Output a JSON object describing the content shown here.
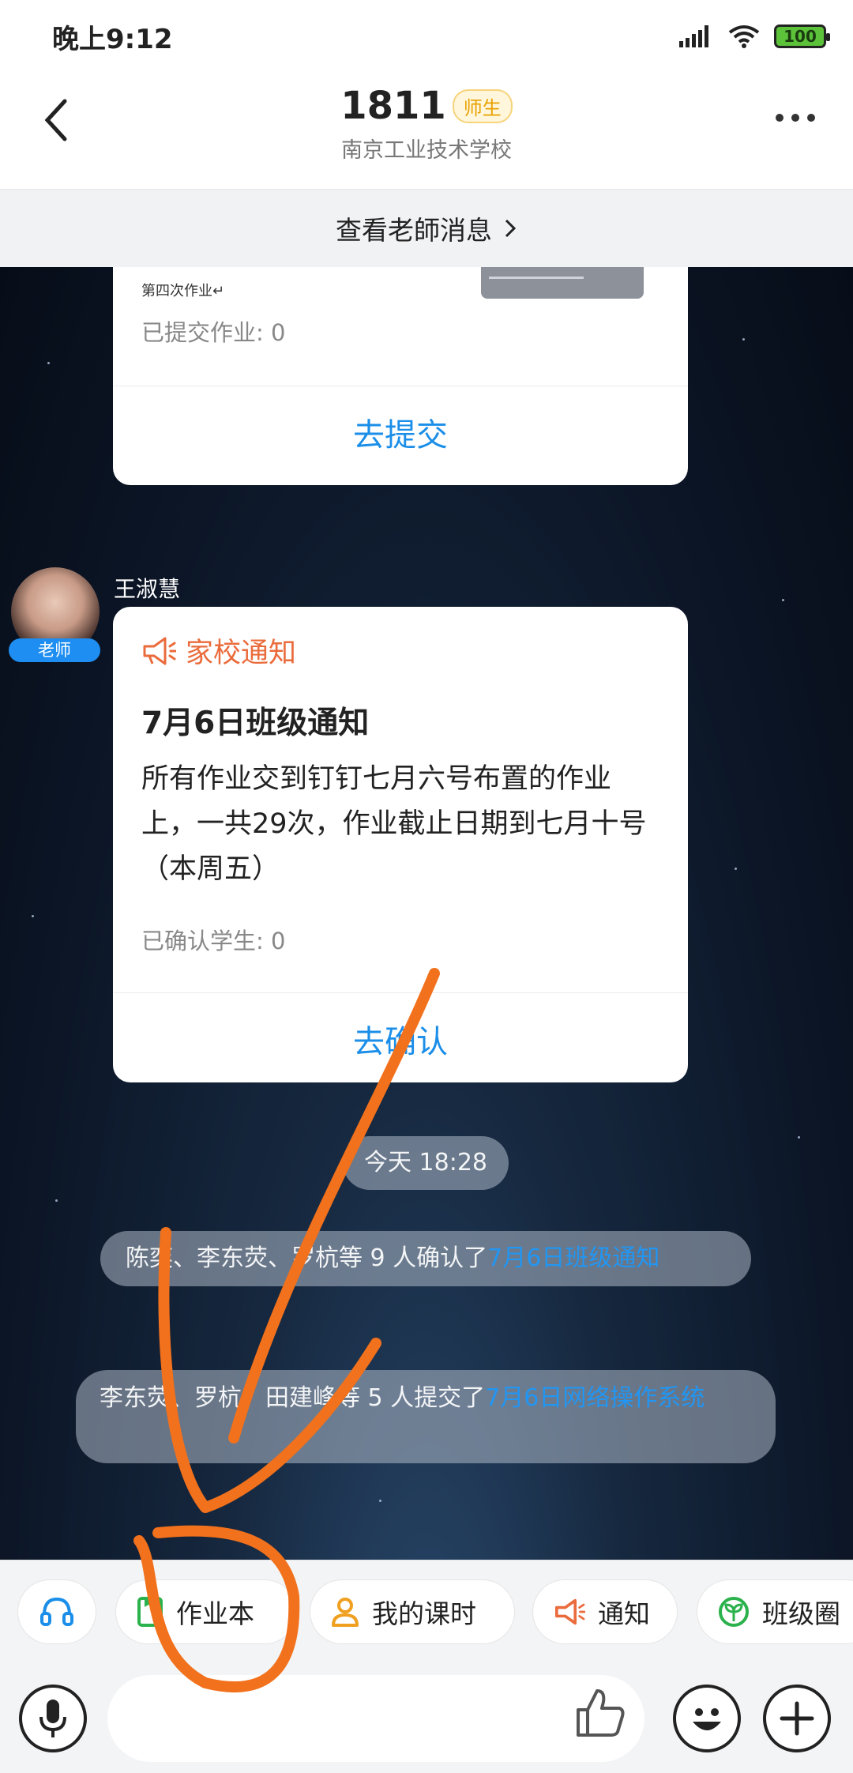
{
  "status_bar": {
    "time": "晚上9:12",
    "battery": "100"
  },
  "header": {
    "title": "1811",
    "badge": "师生",
    "subtitle": "南京工业技术学校"
  },
  "teacher_messages": {
    "label": "查看老師消息"
  },
  "homework_card": {
    "attachment_label": "第四次作业↵",
    "submitted_count": "已提交作业: 0",
    "action": "去提交"
  },
  "message": {
    "sender": "王淑慧",
    "role_tag": "老师",
    "notice_type": "家校通知",
    "title": "7月6日班级通知",
    "body": "所有作业交到钉钉七月六号布置的作业上，一共29次，作业截止日期到七月十号（本周五）",
    "confirmed_count": "已确认学生: 0",
    "action": "去确认"
  },
  "timestamp": "今天 18:28",
  "system_messages": [
    {
      "text": "陈奕、李东荧、罗杭等 9 人确认了",
      "link": "7月6日班级通知"
    },
    {
      "text": "李东荧、罗杭、田建峰等 5 人提交了",
      "link": "7月6日网络操作系统"
    }
  ],
  "quick_actions": [
    {
      "label": ""
    },
    {
      "label": "作业本"
    },
    {
      "label": "我的课时"
    },
    {
      "label": "通知"
    },
    {
      "label": "班级圈"
    }
  ],
  "input": {
    "placeholder": ""
  },
  "colors": {
    "accent": "#1a8ee8",
    "notice": "#ea6b3b",
    "badge": "#e8a200",
    "annotation": "#f2711c"
  }
}
